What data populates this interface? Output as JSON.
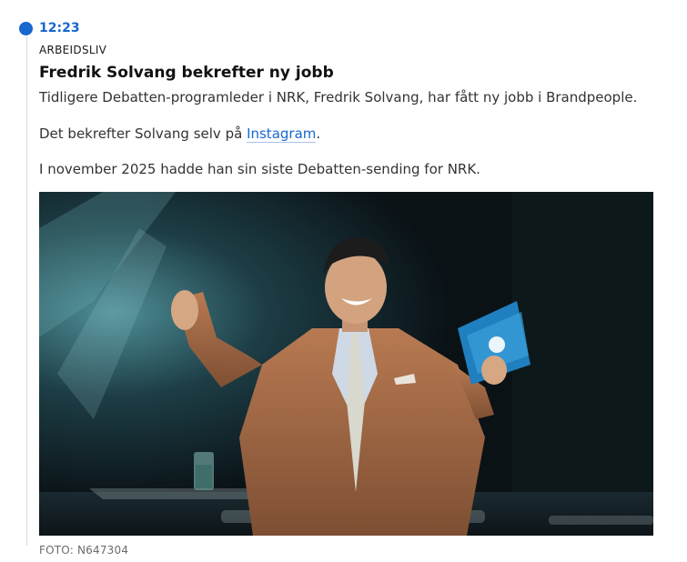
{
  "timeline": {
    "accent_color": "#1767ce"
  },
  "entry": {
    "time": "12:23",
    "category": "ARBEIDSLIV",
    "headline": "Fredrik Solvang bekrefter ny jobb",
    "paragraph_1": "Tidligere Debatten-programleder i NRK, Fredrik Solvang, har fått ny jobb i Brandpeople.",
    "paragraph_2_before": "Det bekrefter Solvang selv på ",
    "paragraph_2_link": "Instagram",
    "paragraph_2_after": ".",
    "paragraph_3": "I november 2025 hadde han sin siste Debatten-sending for NRK.",
    "photo_credit": "FOTO: N647304"
  }
}
